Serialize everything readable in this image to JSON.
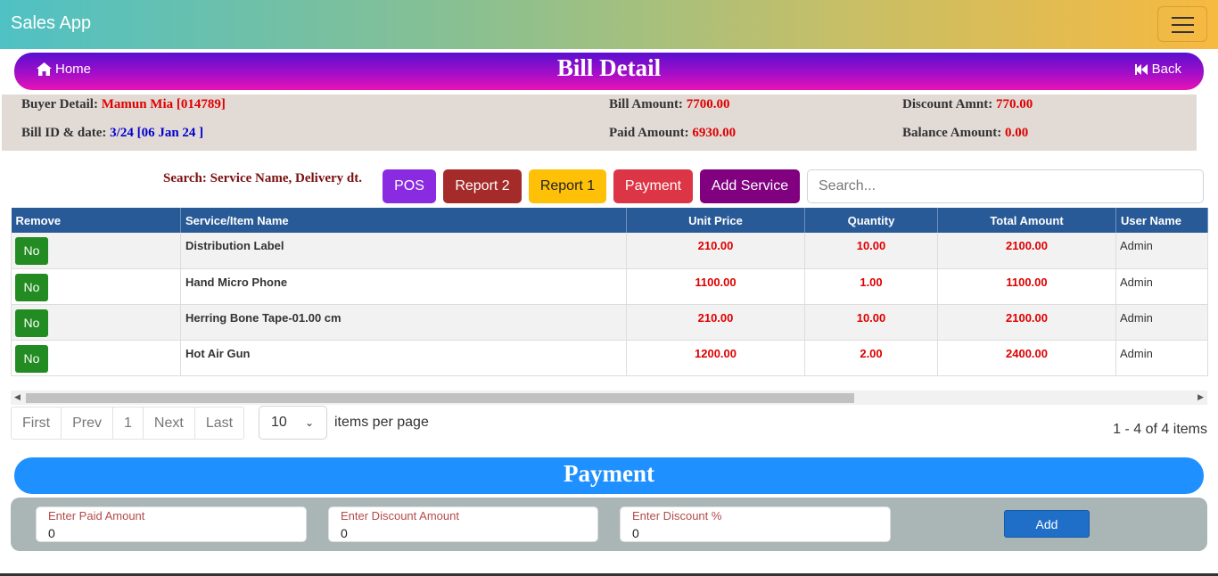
{
  "app": {
    "brand": "Sales App"
  },
  "header": {
    "home_label": "Home",
    "title": "Bill Detail",
    "back_label": "Back"
  },
  "info": {
    "buyer_label": "Buyer Detail:",
    "buyer_value": "Mamun Mia [014789]",
    "bill_label": "Bill ID & date:",
    "bill_value": "3/24 [06 Jan 24 ]",
    "bill_amount_label": "Bill Amount:",
    "bill_amount_value": "7700.00",
    "paid_amount_label": "Paid Amount:",
    "paid_amount_value": "6930.00",
    "discount_label": "Discount Amnt:",
    "discount_value": "770.00",
    "balance_label": "Balance Amount:",
    "balance_value": "0.00"
  },
  "toolbar": {
    "search_label": "Search: Service Name, Delivery dt.",
    "pos_label": "POS",
    "report2_label": "Report 2",
    "report1_label": "Report 1",
    "payment_label": "Payment",
    "add_service_label": "Add Service",
    "search_placeholder": "Search..."
  },
  "colors": {
    "pos": "#8a2be2",
    "report2": "#a52a2a",
    "report1": "#ffc107",
    "payment": "#dc3545",
    "add_service": "#800080"
  },
  "table": {
    "headers": [
      "Remove",
      "Service/Item Name",
      "Unit Price",
      "Quantity",
      "Total Amount",
      "User Name"
    ],
    "rows": [
      {
        "remove": "No",
        "name": "Distribution Label",
        "unit_price": "210.00",
        "quantity": "10.00",
        "total": "2100.00",
        "user": "Admin"
      },
      {
        "remove": "No",
        "name": "Hand Micro Phone",
        "unit_price": "1100.00",
        "quantity": "1.00",
        "total": "1100.00",
        "user": "Admin"
      },
      {
        "remove": "No",
        "name": "Herring Bone Tape-01.00 cm",
        "unit_price": "210.00",
        "quantity": "10.00",
        "total": "2100.00",
        "user": "Admin"
      },
      {
        "remove": "No",
        "name": "Hot Air Gun",
        "unit_price": "1200.00",
        "quantity": "2.00",
        "total": "2400.00",
        "user": "Admin"
      }
    ]
  },
  "pagination": {
    "first": "First",
    "prev": "Prev",
    "page": "1",
    "next": "Next",
    "last": "Last",
    "per_page_value": "10",
    "per_page_label": "items per page",
    "count_text": "1 - 4 of 4 items"
  },
  "payment": {
    "title": "Payment",
    "paid_label": "Enter Paid Amount",
    "paid_value": "0",
    "discount_amount_label": "Enter Discount Amount",
    "discount_amount_value": "0",
    "discount_pct_label": "Enter Discount %",
    "discount_pct_value": "0",
    "add_label": "Add"
  }
}
